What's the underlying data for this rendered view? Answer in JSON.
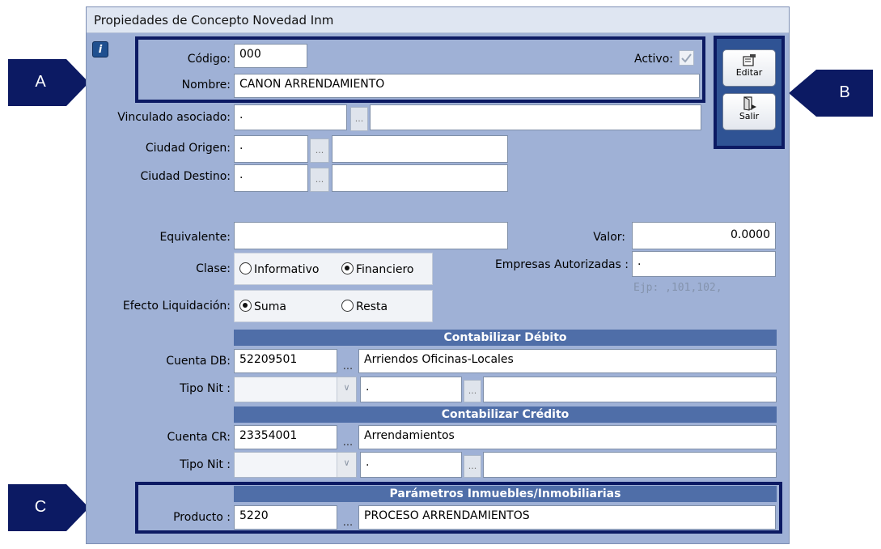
{
  "window": {
    "title": "Propiedades de Concepto Novedad Inm"
  },
  "info_button": "i",
  "callouts": {
    "a": "A",
    "b": "B",
    "c": "C"
  },
  "actions": {
    "edit_label": "Editar",
    "exit_label": "Salir"
  },
  "form": {
    "codigo": {
      "label": "Código:",
      "value": "000"
    },
    "activo": {
      "label": "Activo:",
      "checked": true
    },
    "nombre": {
      "label": "Nombre:",
      "value": "CANON ARRENDAMIENTO"
    },
    "vinculado": {
      "label": "Vinculado asociado:",
      "code": ".",
      "ellipsis": "...",
      "name": ""
    },
    "ciudad_origen": {
      "label": "Ciudad Origen:",
      "code": ".",
      "ellipsis": "...",
      "name": ""
    },
    "ciudad_destino": {
      "label": "Ciudad Destino:",
      "code": ".",
      "ellipsis": "...",
      "name": ""
    },
    "equivalente": {
      "label": "Equivalente:",
      "value": ""
    },
    "valor": {
      "label": "Valor:",
      "value": "0.0000"
    },
    "clase": {
      "label": "Clase:",
      "options": [
        "Informativo",
        "Financiero"
      ],
      "selected": "Financiero"
    },
    "empresas": {
      "label": "Empresas Autorizadas :",
      "value": ".",
      "hint": "Ejp: ,101,102,"
    },
    "efecto": {
      "label": "Efecto Liquidación:",
      "options": [
        "Suma",
        "Resta"
      ],
      "selected": "Suma"
    }
  },
  "debito": {
    "header": "Contabilizar Débito",
    "cuenta": {
      "label": "Cuenta DB:",
      "code": "52209501",
      "ellipsis": "...",
      "name": "Arriendos Oficinas-Locales"
    },
    "tipo_nit": {
      "label": "Tipo Nit :",
      "combo": "",
      "code": ".",
      "ellipsis": "...",
      "name": ""
    }
  },
  "credito": {
    "header": "Contabilizar Crédito",
    "cuenta": {
      "label": "Cuenta CR:",
      "code": "23354001",
      "ellipsis": "...",
      "name": "Arrendamientos"
    },
    "tipo_nit": {
      "label": "Tipo Nit :",
      "combo": "",
      "code": ".",
      "ellipsis": "...",
      "name": ""
    }
  },
  "parametros": {
    "header": "Parámetros Inmuebles/Inmobiliarias",
    "producto": {
      "label": "Producto :",
      "code": "5220",
      "ellipsis": "...",
      "name": "PROCESO ARRENDAMIENTOS"
    }
  },
  "colors": {
    "window_bg": "#9fb1d6",
    "band": "#4f6ea8",
    "callout": "#0c1a63"
  }
}
